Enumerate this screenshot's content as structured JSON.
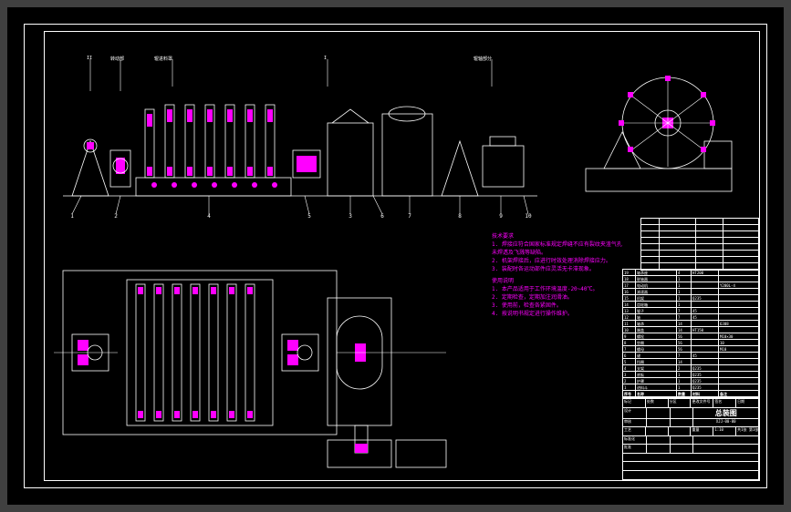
{
  "drawing": {
    "main_title": "总装图",
    "drawing_number": "XJJ-00-00",
    "scale": "1:10",
    "sheet": "共1张 第1张"
  },
  "header_labels": {
    "l1": "II",
    "l2": "转动部",
    "l3": "辊进料罩",
    "l4": "I",
    "l5": "辊轴部分"
  },
  "balloons": {
    "b1": "1",
    "b2": "2",
    "b3": "3",
    "b4": "4",
    "b5": "5",
    "b6": "6",
    "b7": "7",
    "b8": "8",
    "b9": "9",
    "b10": "10"
  },
  "notes": {
    "heading": "技术要求",
    "n1": "1. 焊接应符合国家标准规定焊缝不应有裂纹夹渣气孔",
    "n2": "未焊透及飞溅等缺陷。",
    "n3": "2. 机架焊接后，应进行时效处理消除焊接应力。",
    "n4": "3. 装配时各运动部件应灵活无卡滞现象。",
    "heading2": "使用说明",
    "n5": "1. 本产品适用于工作环境温度-20~40℃。",
    "n6": "2. 定期检查，定期加注润滑油。",
    "n7": "3. 使用前，检查各紧固件。",
    "n8": "4. 按说明书规定进行操作维护。"
  },
  "parts_list": [
    {
      "no": "19",
      "name": "轴承座",
      "qty": "4",
      "mat": "HT200",
      "note": ""
    },
    {
      "no": "18",
      "name": "联轴器",
      "qty": "1",
      "mat": "",
      "note": ""
    },
    {
      "no": "17",
      "name": "电动机",
      "qty": "1",
      "mat": "",
      "note": "Y200L-4"
    },
    {
      "no": "16",
      "name": "减速器",
      "qty": "1",
      "mat": "",
      "note": ""
    },
    {
      "no": "15",
      "name": "机架",
      "qty": "1",
      "mat": "Q235",
      "note": ""
    },
    {
      "no": "14",
      "name": "齿轮箱",
      "qty": "1",
      "mat": "",
      "note": ""
    },
    {
      "no": "13",
      "name": "辊子",
      "qty": "7",
      "mat": "45",
      "note": ""
    },
    {
      "no": "12",
      "name": "轴",
      "qty": "7",
      "mat": "45",
      "note": ""
    },
    {
      "no": "11",
      "name": "轴承",
      "qty": "14",
      "mat": "",
      "note": "6308"
    },
    {
      "no": "10",
      "name": "端盖",
      "qty": "14",
      "mat": "HT150",
      "note": ""
    },
    {
      "no": "9",
      "name": "螺栓",
      "qty": "56",
      "mat": "",
      "note": "M10×30"
    },
    {
      "no": "8",
      "name": "垫圈",
      "qty": "56",
      "mat": "",
      "note": "10"
    },
    {
      "no": "7",
      "name": "螺母",
      "qty": "56",
      "mat": "",
      "note": "M10"
    },
    {
      "no": "6",
      "name": "键",
      "qty": "7",
      "mat": "45",
      "note": ""
    },
    {
      "no": "5",
      "name": "挡圈",
      "qty": "14",
      "mat": "",
      "note": ""
    },
    {
      "no": "4",
      "name": "支架",
      "qty": "2",
      "mat": "Q235",
      "note": ""
    },
    {
      "no": "3",
      "name": "底板",
      "qty": "1",
      "mat": "Q235",
      "note": ""
    },
    {
      "no": "2",
      "name": "护罩",
      "qty": "1",
      "mat": "Q235",
      "note": ""
    },
    {
      "no": "1",
      "name": "进料斗",
      "qty": "1",
      "mat": "Q235",
      "note": ""
    }
  ],
  "parts_header": {
    "no": "序号",
    "name": "名称",
    "qty": "数量",
    "mat": "材料",
    "note": "备注"
  },
  "upper_table": [
    {
      "c1": "",
      "c2": "",
      "c3": "",
      "c4": ""
    },
    {
      "c1": "",
      "c2": "",
      "c3": "",
      "c4": ""
    },
    {
      "c1": "",
      "c2": "",
      "c3": "",
      "c4": ""
    },
    {
      "c1": "",
      "c2": "",
      "c3": "",
      "c4": ""
    },
    {
      "c1": "",
      "c2": "",
      "c3": "",
      "c4": ""
    },
    {
      "c1": "",
      "c2": "",
      "c3": "",
      "c4": ""
    },
    {
      "c1": "",
      "c2": "",
      "c3": "",
      "c4": ""
    },
    {
      "c1": "",
      "c2": "",
      "c3": "",
      "c4": ""
    }
  ],
  "title_block": {
    "r1c1": "标记",
    "r1c2": "处数",
    "r1c3": "分区",
    "r1c4": "更改文件号",
    "r1c5": "签名",
    "r1c6": "日期",
    "designed": "设计",
    "checked": "审核",
    "approved": "批准",
    "std": "标准化",
    "weight": "重量",
    "proj": "工艺"
  }
}
